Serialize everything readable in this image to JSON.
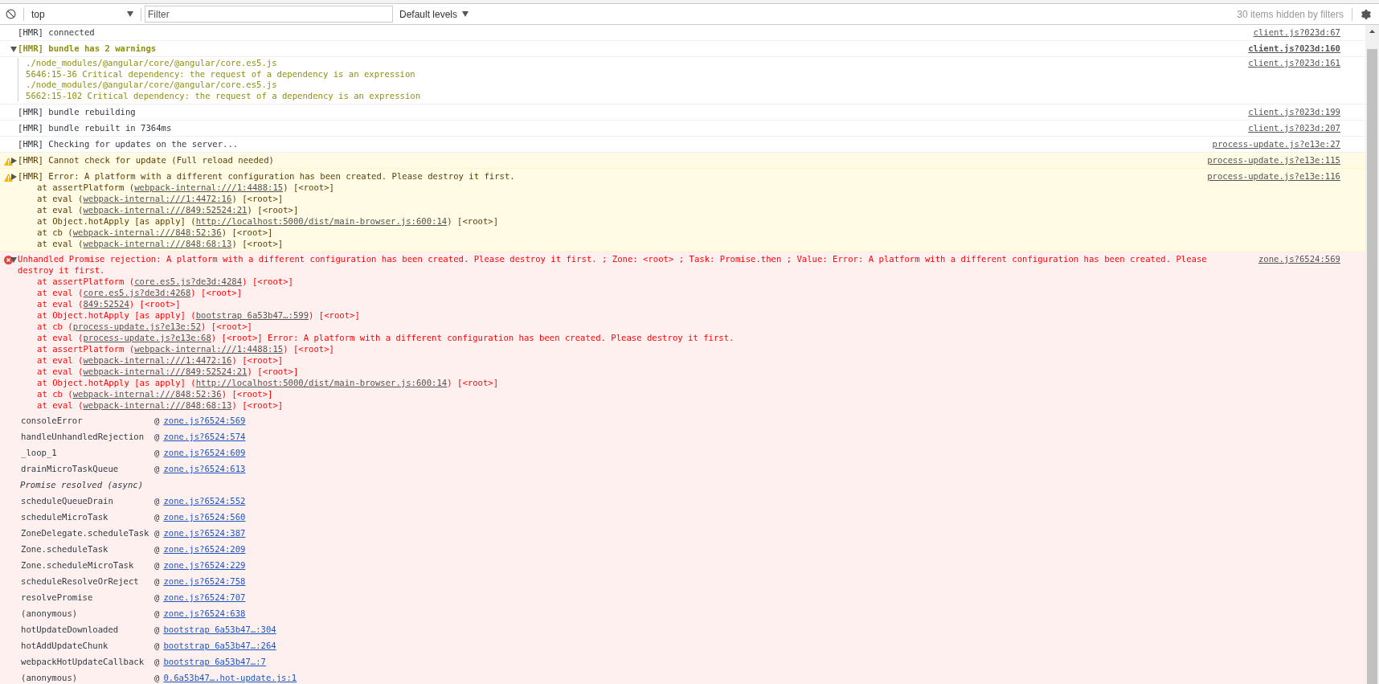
{
  "toolbar": {
    "context": "top",
    "filter_placeholder": "Filter",
    "levels": "Default levels",
    "hidden": "30 items hidden by filters"
  },
  "messages": [
    {
      "kind": "info",
      "text": "[HMR] connected",
      "source": "client.js?023d:67"
    },
    {
      "kind": "group",
      "expanded": true,
      "text": "[HMR] bundle has 2 warnings",
      "source": "client.js?023d:160",
      "children": [
        {
          "source": "client.js?023d:161",
          "lines": [
            "./node_modules/@angular/core/@angular/core.es5.js",
            "5646:15-36 Critical dependency: the request of a dependency is an expression",
            "./node_modules/@angular/core/@angular/core.es5.js",
            "5662:15-102 Critical dependency: the request of a dependency is an expression"
          ]
        }
      ]
    },
    {
      "kind": "info",
      "text": "[HMR] bundle rebuilding",
      "source": "client.js?023d:199"
    },
    {
      "kind": "info",
      "text": "[HMR] bundle rebuilt in 7364ms",
      "source": "client.js?023d:207"
    },
    {
      "kind": "info",
      "text": "[HMR] Checking for updates on the server...",
      "source": "process-update.js?e13e:27"
    },
    {
      "kind": "warning",
      "expanded": false,
      "text": "[HMR] Cannot check for update (Full reload needed)",
      "source": "process-update.js?e13e:115"
    },
    {
      "kind": "warning",
      "expanded": false,
      "text": "[HMR] Error: A platform with a different configuration has been created. Please destroy it first.",
      "source": "process-update.js?e13e:116",
      "stack": [
        {
          "before": "at assertPlatform (",
          "link": "webpack-internal:///1:4488:15",
          "after": ") [<root>]"
        },
        {
          "before": "at eval (",
          "link": "webpack-internal:///1:4472:16",
          "after": ") [<root>]"
        },
        {
          "before": "at eval (",
          "link": "webpack-internal:///849:52524:21",
          "after": ") [<root>]"
        },
        {
          "before": "at Object.hotApply [as apply] (",
          "link": "http://localhost:5000/dist/main-browser.js:600:14",
          "after": ") [<root>]"
        },
        {
          "before": "at cb (",
          "link": "webpack-internal:///848:52:36",
          "after": ") [<root>]"
        },
        {
          "before": "at eval (",
          "link": "webpack-internal:///848:68:13",
          "after": ") [<root>]"
        }
      ]
    },
    {
      "kind": "error",
      "expanded": true,
      "text": "Unhandled Promise rejection: A platform with a different configuration has been created. Please destroy it first. ; Zone: <root> ; Task: Promise.then ; Value: Error: A platform with a different configuration has been created. Please destroy it first.",
      "source": "zone.js?6524:569",
      "stack": [
        {
          "before": "at assertPlatform (",
          "link": "core.es5.js?de3d:4284",
          "after": ") [<root>]"
        },
        {
          "before": "at eval (",
          "link": "core.es5.js?de3d:4268",
          "after": ") [<root>]"
        },
        {
          "before": "at eval (",
          "link": "849:52524",
          "after": ") [<root>]"
        },
        {
          "before": "at Object.hotApply [as apply] (",
          "link": "bootstrap 6a53b47…:599",
          "after": ") [<root>]"
        },
        {
          "before": "at cb (",
          "link": "process-update.js?e13e:52",
          "after": ") [<root>]"
        },
        {
          "before": "at eval (",
          "link": "process-update.js?e13e:68",
          "after": ") [<root>] Error: A platform with a different configuration has been created. Please destroy it first."
        },
        {
          "before": "at assertPlatform (",
          "link": "webpack-internal:///1:4488:15",
          "after": ") [<root>]"
        },
        {
          "before": "at eval (",
          "link": "webpack-internal:///1:4472:16",
          "after": ") [<root>]"
        },
        {
          "before": "at eval (",
          "link": "webpack-internal:///849:52524:21",
          "after": ") [<root>]"
        },
        {
          "before": "at Object.hotApply [as apply] (",
          "link": "http://localhost:5000/dist/main-browser.js:600:14",
          "after": ") [<root>]"
        },
        {
          "before": "at cb (",
          "link": "webpack-internal:///848:52:36",
          "after": ") [<root>]"
        },
        {
          "before": "at eval (",
          "link": "webpack-internal:///848:68:13",
          "after": ") [<root>]"
        }
      ],
      "trace": [
        {
          "kind": "frame",
          "fn": "consoleError",
          "at": "@",
          "source": "zone.js?6524:569"
        },
        {
          "kind": "frame",
          "fn": "handleUnhandledRejection",
          "at": "@",
          "source": "zone.js?6524:574"
        },
        {
          "kind": "frame",
          "fn": "_loop_1",
          "at": "@",
          "source": "zone.js?6524:609"
        },
        {
          "kind": "frame",
          "fn": "drainMicroTaskQueue",
          "at": "@",
          "source": "zone.js?6524:613"
        },
        {
          "kind": "async",
          "text": "Promise resolved (async)"
        },
        {
          "kind": "frame",
          "fn": "scheduleQueueDrain",
          "at": "@",
          "source": "zone.js?6524:552"
        },
        {
          "kind": "frame",
          "fn": "scheduleMicroTask",
          "at": "@",
          "source": "zone.js?6524:560"
        },
        {
          "kind": "frame",
          "fn": "ZoneDelegate.scheduleTask",
          "at": "@",
          "source": "zone.js?6524:387"
        },
        {
          "kind": "frame",
          "fn": "Zone.scheduleTask",
          "at": "@",
          "source": "zone.js?6524:209"
        },
        {
          "kind": "frame",
          "fn": "Zone.scheduleMicroTask",
          "at": "@",
          "source": "zone.js?6524:229"
        },
        {
          "kind": "frame",
          "fn": "scheduleResolveOrReject",
          "at": "@",
          "source": "zone.js?6524:758"
        },
        {
          "kind": "frame",
          "fn": "resolvePromise",
          "at": "@",
          "source": "zone.js?6524:707"
        },
        {
          "kind": "frame",
          "fn": "(anonymous)",
          "at": "@",
          "source": "zone.js?6524:638"
        },
        {
          "kind": "frame",
          "fn": "hotUpdateDownloaded",
          "at": "@",
          "source": "bootstrap 6a53b47…:304"
        },
        {
          "kind": "frame",
          "fn": "hotAddUpdateChunk",
          "at": "@",
          "source": "bootstrap 6a53b47…:264"
        },
        {
          "kind": "frame",
          "fn": "webpackHotUpdateCallback",
          "at": "@",
          "source": "bootstrap 6a53b47…:7"
        },
        {
          "kind": "frame",
          "fn": "(anonymous)",
          "at": "@",
          "source": "0.6a53b47….hot-update.js:1"
        }
      ]
    }
  ]
}
